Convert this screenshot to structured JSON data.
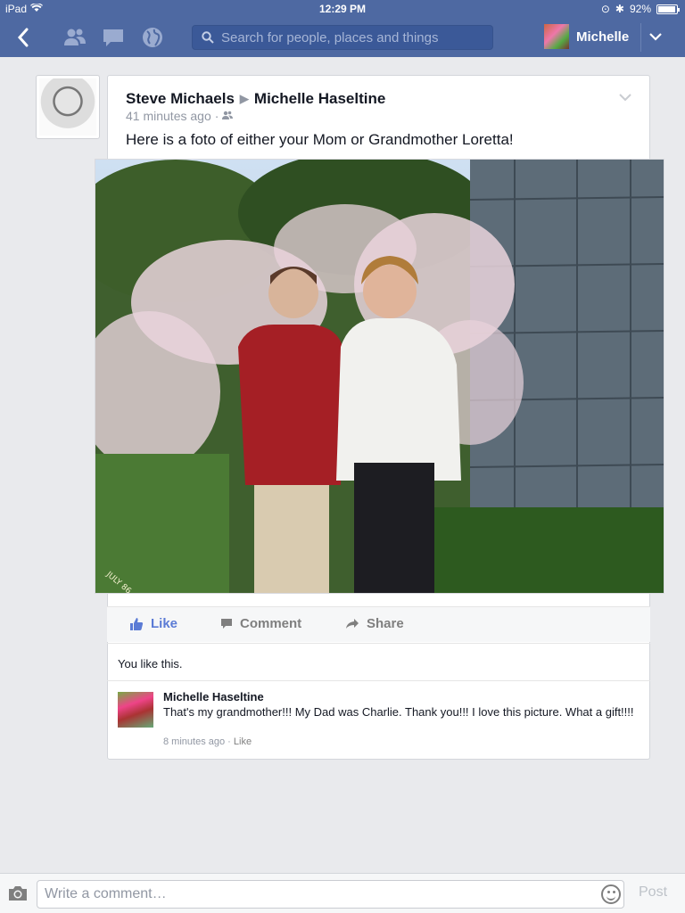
{
  "status_bar": {
    "device": "iPad",
    "time": "12:29 PM",
    "battery": "92%"
  },
  "nav": {
    "search_placeholder": "Search for people, places and things",
    "user_name": "Michelle"
  },
  "post": {
    "author": "Steve Michaels",
    "recipient": "Michelle Haseltine",
    "time_ago": "41 minutes ago",
    "separator": "·",
    "text": "Here is a foto of either your Mom or Grandmother Loretta!",
    "photo_stamp": "JULY 86"
  },
  "actions": {
    "like": "Like",
    "comment": "Comment",
    "share": "Share"
  },
  "likes_text": "You like this.",
  "comment": {
    "author": "Michelle Haseltine",
    "text": "That's my grandmother!!! My Dad was Charlie. Thank you!!! I love this picture. What a gift!!!!",
    "time_ago": "8 minutes ago",
    "separator": "·",
    "like": "Like"
  },
  "composer": {
    "placeholder": "Write a comment…",
    "post_label": "Post"
  },
  "colors": {
    "nav_bg": "#4e69a2",
    "like_blue": "#5b7bd5"
  }
}
